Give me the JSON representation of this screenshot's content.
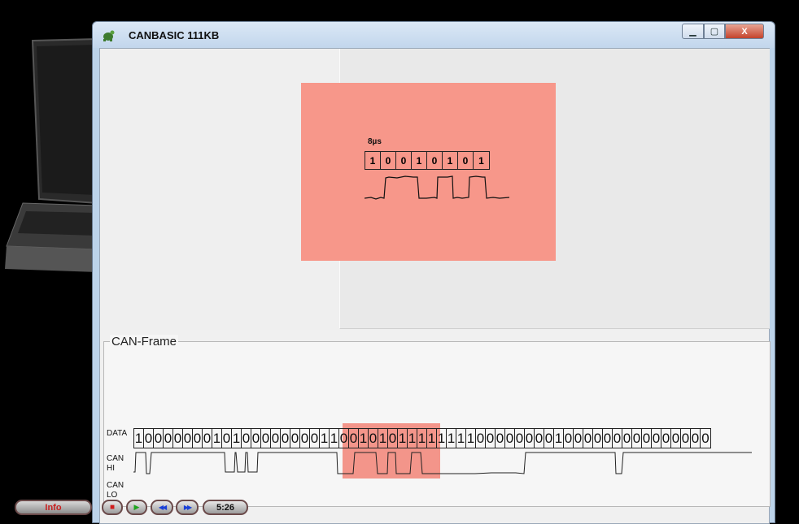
{
  "window": {
    "title": "CANBASIC 111KB",
    "minimize_glyph": "▁",
    "maximize_glyph": "▢",
    "close_glyph": "X"
  },
  "preview": {
    "bit_time_label": "8µs",
    "bits": [
      "1",
      "0",
      "0",
      "1",
      "0",
      "1",
      "0",
      "1"
    ]
  },
  "can_frame": {
    "group_title": "CAN-Frame",
    "data_label": "DATA",
    "can_hi_label": "CAN\nHI",
    "can_lo_label": "CAN\nLO",
    "bits": [
      "1",
      "0",
      "0",
      "0",
      "0",
      "0",
      "0",
      "0",
      "1",
      "0",
      "1",
      "0",
      "0",
      "0",
      "0",
      "0",
      "0",
      "0",
      "0",
      "1",
      "1",
      "0",
      "0",
      "1",
      "0",
      "1",
      "0",
      "1",
      "1",
      "1",
      "1",
      "1",
      "1",
      "1",
      "1",
      "0",
      "0",
      "0",
      "0",
      "0",
      "0",
      "0",
      "0",
      "1",
      "0",
      "0",
      "0",
      "0",
      "0",
      "0",
      "0",
      "0",
      "0",
      "0",
      "0",
      "0",
      "0",
      "0",
      "0"
    ],
    "highlight_colour": "#f04632"
  },
  "player": {
    "info_label": "Info",
    "stop_glyph": "■",
    "play_glyph": "▶",
    "rewind_glyph": "◀◀",
    "forward_glyph": "▶▶",
    "time": "5:26"
  },
  "colors": {
    "preview_box": "#f7978a",
    "info_text": "#c82020"
  }
}
